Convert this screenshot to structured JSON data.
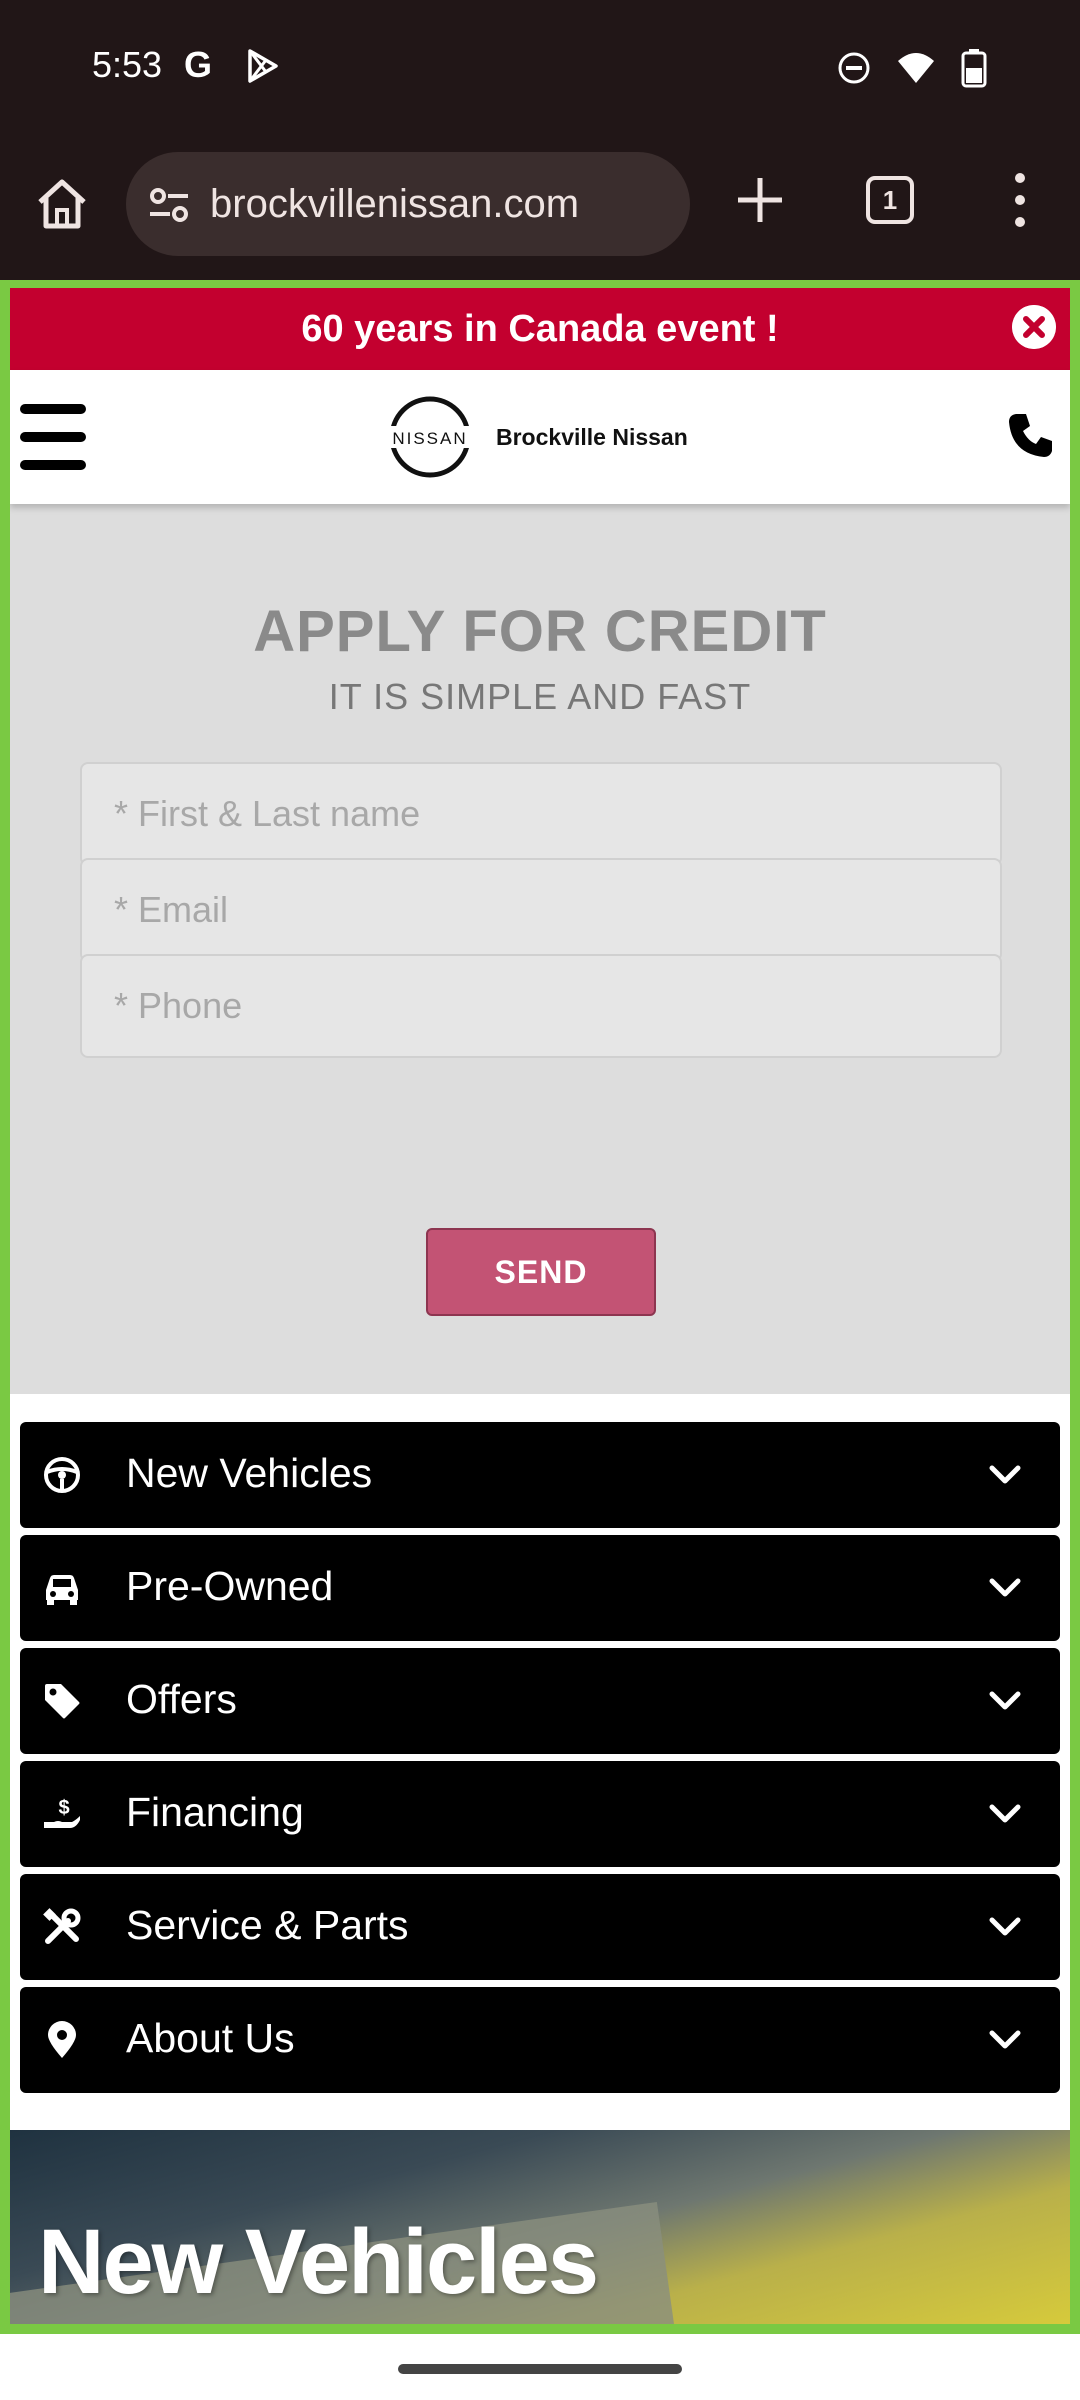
{
  "status_bar": {
    "time": "5:53",
    "glyph_google": "G",
    "icons": [
      "google-icon",
      "play-store-icon",
      "do-not-disturb-icon",
      "wifi-icon",
      "battery-icon"
    ]
  },
  "browser": {
    "url": "brockvillenissan.com",
    "tab_count": "1",
    "icons": [
      "home-icon",
      "site-settings-icon",
      "new-tab-icon",
      "tab-switcher-icon",
      "more-menu-icon"
    ]
  },
  "promo": {
    "text": "60 years in Canada event !"
  },
  "header": {
    "logo_text": "NISSAN",
    "brand_name": "Brockville Nissan"
  },
  "credit": {
    "title": "APPLY FOR CREDIT",
    "subtitle": "IT IS SIMPLE AND FAST",
    "fields": {
      "name_placeholder": "* First & Last name",
      "email_placeholder": "* Email",
      "phone_placeholder": "* Phone"
    },
    "send_label": "SEND"
  },
  "nav": {
    "items": [
      {
        "label": "New Vehicles",
        "icon": "steering-wheel-icon"
      },
      {
        "label": "Pre-Owned",
        "icon": "car-icon"
      },
      {
        "label": "Offers",
        "icon": "tag-icon"
      },
      {
        "label": "Financing",
        "icon": "hand-dollar-icon"
      },
      {
        "label": "Service & Parts",
        "icon": "tools-icon"
      },
      {
        "label": "About Us",
        "icon": "map-pin-icon"
      }
    ]
  },
  "hero": {
    "title": "New Vehicles"
  },
  "colors": {
    "promo_red": "#c3002f",
    "send_pink": "#c35374",
    "frame_green": "#7ac943",
    "nav_black": "#000000"
  }
}
